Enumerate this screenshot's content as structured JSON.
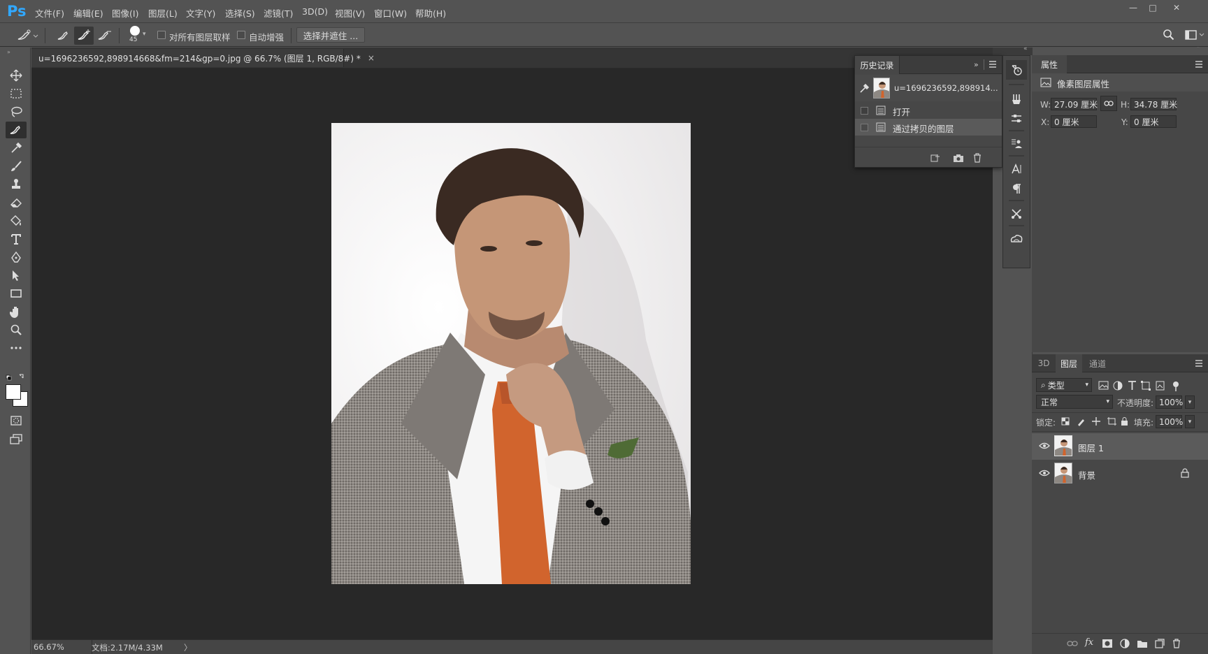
{
  "app": {
    "logo": "Ps"
  },
  "menu": [
    "文件(F)",
    "编辑(E)",
    "图像(I)",
    "图层(L)",
    "文字(Y)",
    "选择(S)",
    "滤镜(T)",
    "3D(D)",
    "视图(V)",
    "窗口(W)",
    "帮助(H)"
  ],
  "window_controls": {
    "minimize": "—",
    "maximize": "□",
    "close": "✕"
  },
  "options": {
    "brush_size": "45",
    "sample_all_layers": "对所有图层取样",
    "auto_enhance": "自动增强",
    "refine_button": "选择并遮住 ..."
  },
  "document": {
    "tab_title": "u=1696236592,898914668&fm=214&gp=0.jpg @ 66.7% (图层 1, RGB/8#) *",
    "close": "×",
    "zoom": "66.67%",
    "doc_info": "文档:2.17M/4.33M",
    "arrow": "〉"
  },
  "history": {
    "title": "历史记录",
    "snapshot_name": "u=1696236592,898914...",
    "items": [
      {
        "label": "打开"
      },
      {
        "label": "通过拷贝的图层"
      }
    ]
  },
  "properties": {
    "title": "属性",
    "subtitle": "像素图层属性",
    "w_label": "W:",
    "w_value": "27.09 厘米",
    "h_label": "H:",
    "h_value": "34.78 厘米",
    "x_label": "X:",
    "x_value": "0 厘米",
    "y_label": "Y:",
    "y_value": "0 厘米"
  },
  "layers": {
    "tabs": [
      "3D",
      "图层",
      "通道"
    ],
    "filter": "类型",
    "blend_mode": "正常",
    "opacity_label": "不透明度:",
    "opacity_value": "100%",
    "lock_label": "锁定:",
    "fill_label": "填充:",
    "fill_value": "100%",
    "items": [
      {
        "name": "图层 1"
      },
      {
        "name": "背景"
      }
    ],
    "fx": "fx"
  },
  "colors": {
    "ps_blue": "#31a8ff",
    "panel": "#474747",
    "chrome": "#535353",
    "workspace": "#282828",
    "tie_orange": "#d1642d"
  }
}
